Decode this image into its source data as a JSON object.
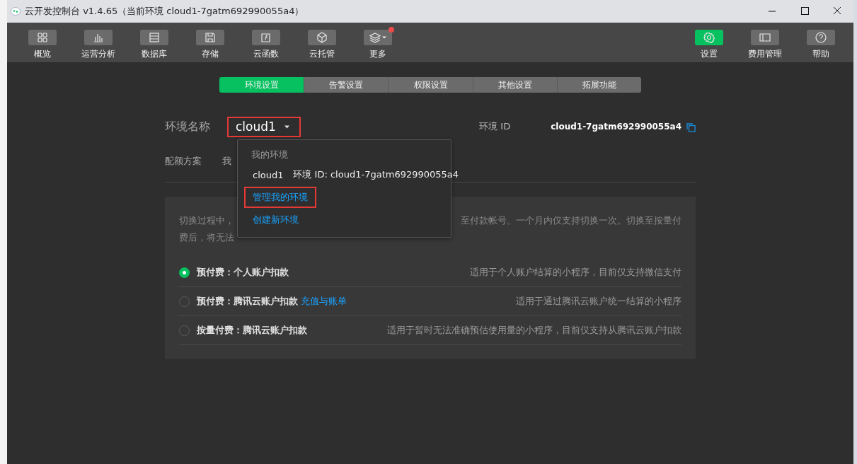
{
  "window": {
    "title": "云开发控制台 v1.4.65（当前环境 cloud1-7gatm692990055a4）"
  },
  "toolbar": {
    "left": [
      {
        "label": "概览",
        "selected": false,
        "notification": false
      },
      {
        "label": "运营分析",
        "selected": false,
        "notification": false
      },
      {
        "label": "数据库",
        "selected": false,
        "notification": false
      },
      {
        "label": "存储",
        "selected": false,
        "notification": false
      },
      {
        "label": "云函数",
        "selected": false,
        "notification": false
      },
      {
        "label": "云托管",
        "selected": false,
        "notification": false
      },
      {
        "label": "更多",
        "selected": false,
        "notification": true
      }
    ],
    "right": [
      {
        "label": "设置",
        "selected": true,
        "notification": false
      },
      {
        "label": "费用管理",
        "selected": false,
        "notification": false
      },
      {
        "label": "帮助",
        "selected": false,
        "notification": false
      }
    ]
  },
  "tabs": [
    {
      "label": "环境设置",
      "selected": true
    },
    {
      "label": "告警设置",
      "selected": false
    },
    {
      "label": "权限设置",
      "selected": false
    },
    {
      "label": "其他设置",
      "selected": false
    },
    {
      "label": "拓展功能",
      "selected": false
    }
  ],
  "environment": {
    "name_label": "环境名称",
    "name_value": "cloud1",
    "highlighted": true,
    "id_label": "环境 ID",
    "id_value": "cloud1-7gatm692990055a4"
  },
  "quota": {
    "label": "配额方案",
    "column_2": "我"
  },
  "dropdown": {
    "header": "我的环境",
    "items": [
      {
        "kind": "env",
        "name": "cloud1",
        "detail": "环境 ID: cloud1-7gatm692990055a4",
        "highlighted": false
      },
      {
        "kind": "link",
        "name": "管理我的环境",
        "highlighted": true
      },
      {
        "kind": "link",
        "name": "创建新环境",
        "highlighted": false
      }
    ]
  },
  "notice": {
    "line_1_left": "切换过程中，",
    "line_1_right": "至付款帐号。一个月内仅支持切换一次。切换至按量付",
    "line_2": "费后，将无法"
  },
  "plans": [
    {
      "label": "预付费：个人账户扣款",
      "description": "适用于个人账户结算的小程序，目前仅支持微信支付",
      "selected": true
    },
    {
      "label": "预付费：腾讯云账户扣款",
      "link": "充值与账单",
      "description": "适用于通过腾讯云账户统一结算的小程序",
      "selected": false
    },
    {
      "label": "按量付费：腾讯云账户扣款",
      "description": "适用于暂时无法准确预估使用量的小程序，目前仅支持从腾讯云账户扣款",
      "selected": false
    }
  ]
}
